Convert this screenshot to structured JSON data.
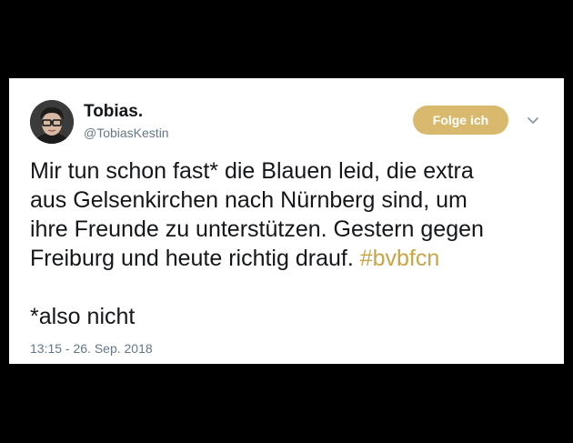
{
  "user": {
    "display_name": "Tobias.",
    "handle": "@TobiasKestin"
  },
  "actions": {
    "follow_label": "Folge ich"
  },
  "tweet": {
    "lines": [
      "Mir tun schon fast* die Blauen leid, die extra",
      "aus Gelsenkirchen nach Nürnberg sind, um",
      "ihre Freunde zu unterstützen. Gestern gegen",
      "Freiburg und heute richtig drauf. "
    ],
    "hashtag": "#bvbfcn",
    "footnote": "*also nicht",
    "timestamp": "13:15 - 26. Sep. 2018"
  },
  "icons": {
    "avatar": "avatar",
    "menu": "chevron-down-icon"
  },
  "colors": {
    "accent": "#d9b96e",
    "hashtag": "#c9a548",
    "text": "#14171a",
    "muted": "#657786",
    "background": "#000000",
    "card": "#ffffff"
  }
}
